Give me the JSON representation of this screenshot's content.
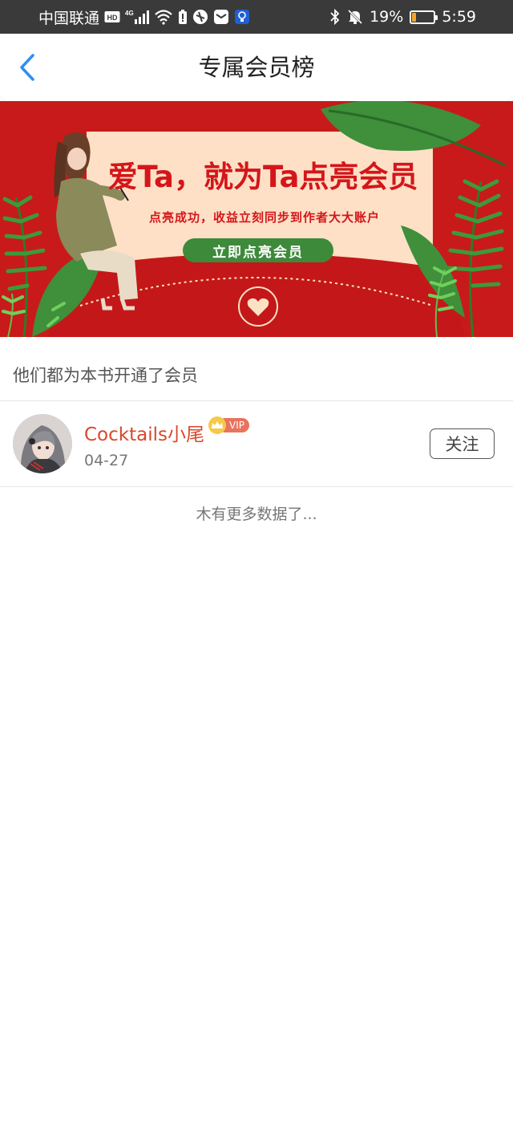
{
  "status_bar": {
    "carrier": "中国联通",
    "network": "4G",
    "battery_percent": "19%",
    "battery_level": 0.19,
    "time": "5:59",
    "icons": [
      "hd-icon",
      "signal-icon",
      "wifi-icon",
      "battery-alert-icon",
      "app-icon",
      "mail-icon",
      "lightbulb-icon",
      "bluetooth-icon",
      "mute-icon"
    ]
  },
  "header": {
    "title": "专属会员榜",
    "back_icon": "chevron-left-icon",
    "accent": "#2f8ff0"
  },
  "banner": {
    "headline": "爱Ta，就为Ta点亮会员",
    "subtitle": "点亮成功，收益立刻同步到作者大大账户",
    "cta_label": "立即点亮会员",
    "colors": {
      "background": "#c81a1a",
      "card": "#fde0c6",
      "cta": "#3d8a3a",
      "text": "#d4161a"
    }
  },
  "section": {
    "title": "他们都为本书开通了会员"
  },
  "members": [
    {
      "name": "Cocktails小尾",
      "badge": "VIP",
      "date": "04-27",
      "follow_label": "关注"
    }
  ],
  "list_footer": "木有更多数据了..."
}
